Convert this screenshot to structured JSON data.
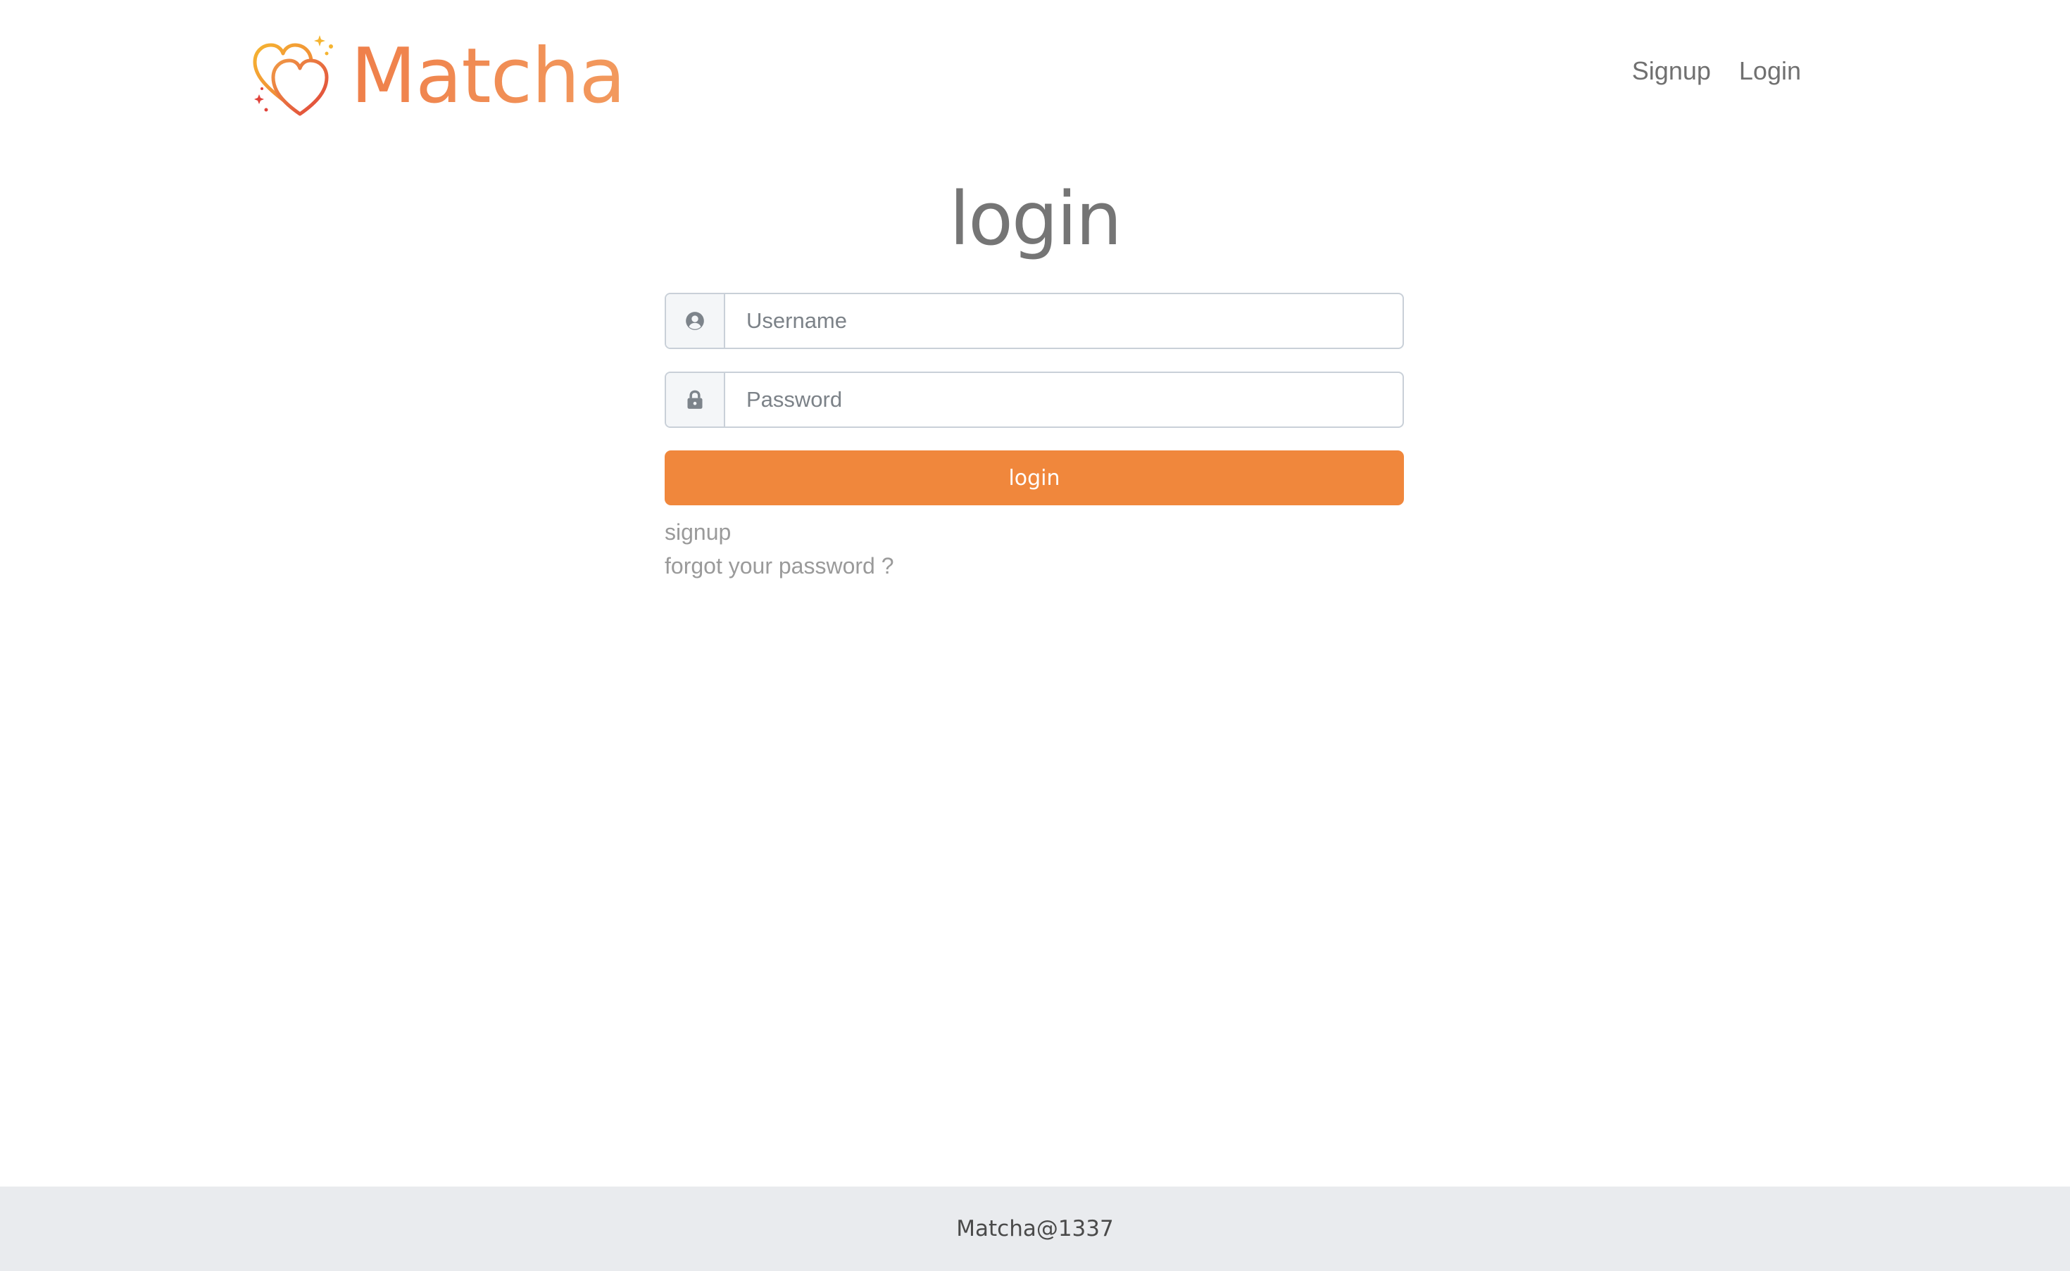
{
  "brand": {
    "name": "Matcha",
    "logo_icon": "double-heart-logo-icon",
    "accent_color": "#f0873c"
  },
  "nav": {
    "signup_label": "Signup",
    "login_label": "Login"
  },
  "form": {
    "title": "login",
    "username": {
      "icon": "user-circle-icon",
      "placeholder": "Username",
      "value": ""
    },
    "password": {
      "icon": "lock-icon",
      "placeholder": "Password",
      "value": ""
    },
    "submit_label": "login",
    "signup_link": "signup",
    "forgot_link": "forgot your password ?"
  },
  "footer": {
    "text": "Matcha@1337"
  }
}
